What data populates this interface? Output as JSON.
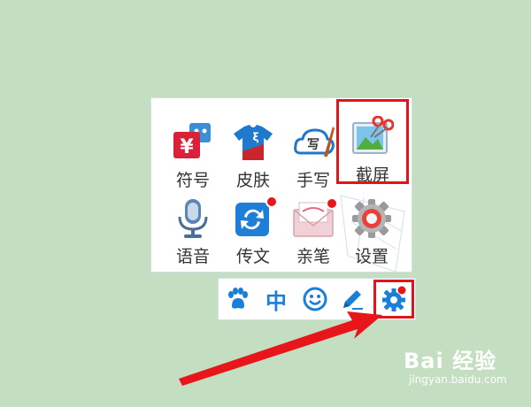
{
  "panel": {
    "items": [
      {
        "label": "符号",
        "icon": "symbol-icon"
      },
      {
        "label": "皮肤",
        "icon": "skin-shirt-icon"
      },
      {
        "label": "手写",
        "icon": "handwriting-icon"
      },
      {
        "label": "截屏",
        "icon": "screenshot-scissors-icon",
        "highlighted": true
      },
      {
        "label": "语音",
        "icon": "microphone-icon"
      },
      {
        "label": "传文",
        "icon": "transfer-icon",
        "badge": true
      },
      {
        "label": "亲笔",
        "icon": "envelope-icon",
        "badge": true
      },
      {
        "label": "设置",
        "icon": "settings-gear-icon"
      }
    ]
  },
  "toolbar": {
    "zh_label": "中",
    "buttons": [
      "paw-icon",
      "chinese-mode",
      "emoji-icon",
      "pen-icon",
      "settings-gear-icon"
    ]
  },
  "watermark": {
    "main": "Bai 经验",
    "sub": "jingyan.baidu.com"
  },
  "colors": {
    "background": "#c3dec1",
    "highlight": "#e0151a",
    "accent": "#1a7fd9",
    "badge": "#e8161b"
  }
}
